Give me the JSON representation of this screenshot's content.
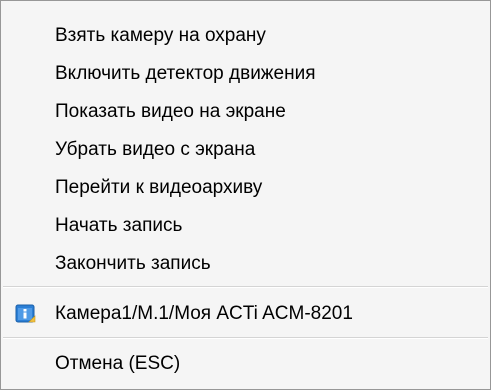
{
  "menu": {
    "items": [
      {
        "label": "Взять камеру на охрану"
      },
      {
        "label": "Включить детектор движения"
      },
      {
        "label": "Показать видео на экране"
      },
      {
        "label": "Убрать видео с экрана"
      },
      {
        "label": "Перейти к видеоархиву"
      },
      {
        "label": "Начать запись"
      },
      {
        "label": "Закончить запись"
      }
    ],
    "camera_item": {
      "label": "Камера1/М.1/Моя ACTi ACM-8201",
      "icon": "info-window-icon"
    },
    "cancel_item": {
      "label": "Отмена (ESC)"
    }
  },
  "colors": {
    "background": "#f5f5f5",
    "border": "#979797",
    "icon_blue": "#2b7fd6"
  }
}
